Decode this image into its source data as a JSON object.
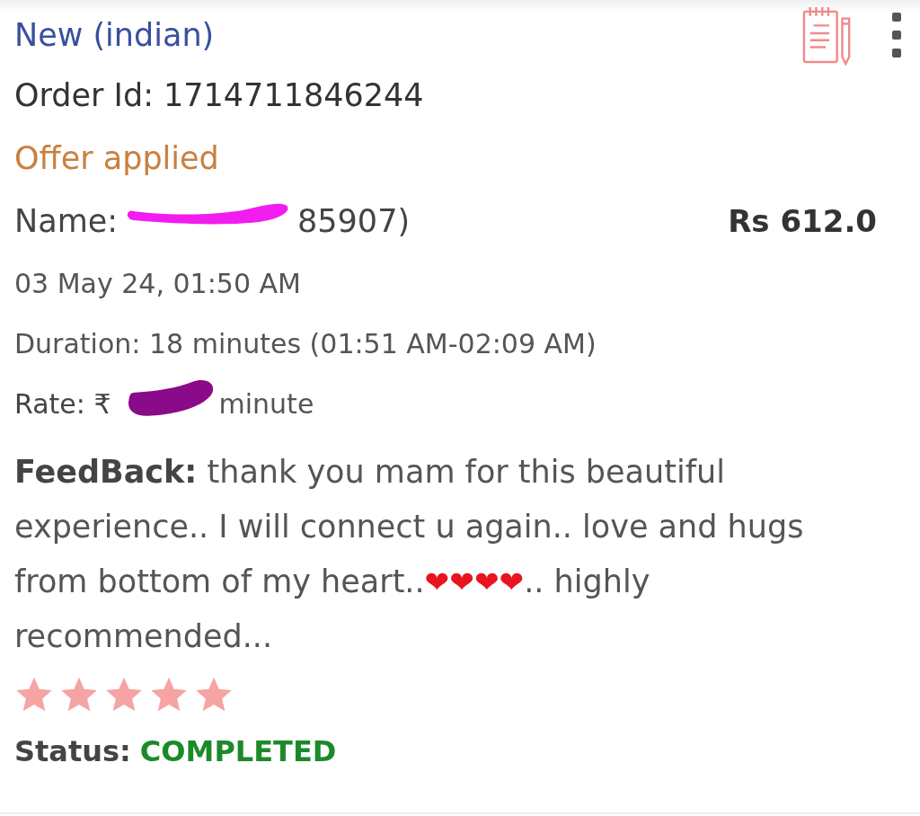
{
  "title": "New (indian)",
  "order_id": "Order Id: 1714711846244",
  "offer": "Offer applied",
  "name": {
    "label": "Name:",
    "value": "85907)"
  },
  "price": "Rs 612.0",
  "date": "03 May 24, 01:50 AM",
  "duration": "Duration: 18 minutes (01:51 AM-02:09 AM)",
  "rate": {
    "label": "Rate: ₹",
    "value": "minute"
  },
  "feedback": {
    "label": "FeedBack:",
    "segments": [
      {
        "kind": "text",
        "text": "thank you mam for this beautiful experience.. I will connect u again.. love and hugs from bottom of my heart.."
      },
      {
        "kind": "emoji",
        "text": "❤❤❤❤"
      },
      {
        "kind": "text",
        "text": ".. highly recommended..."
      }
    ]
  },
  "rating": {
    "stars": 5
  },
  "status": {
    "label": "Status:",
    "value": "COMPLETED"
  }
}
